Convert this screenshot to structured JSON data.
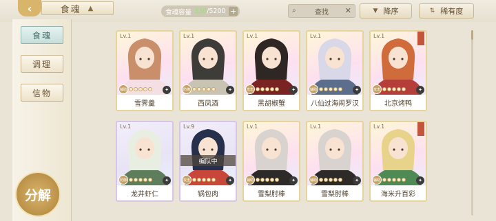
{
  "header": {
    "back_icon": "chevron-left-icon",
    "title": "食魂",
    "capacity_label": "食魂容量",
    "capacity_current": "330",
    "capacity_max": "/5200",
    "search_placeholder": "查找",
    "sort_order_label": "降序",
    "sort_key_label": "稀有度"
  },
  "sidebar": {
    "tabs": [
      {
        "label": "食魂",
        "active": true
      },
      {
        "label": "调理",
        "active": false
      },
      {
        "label": "信物",
        "active": false
      }
    ],
    "decompose_label": "分解"
  },
  "cards": [
    {
      "level": "Lv.1",
      "name": "雪霁羹",
      "role": "辅助",
      "team": "",
      "hair": "#c98f6a",
      "robe": "#f3dfe4",
      "flag": false
    },
    {
      "level": "Lv.1",
      "name": "西凤酒",
      "role": "防御",
      "team": "",
      "hair": "#3e3c38",
      "robe": "#c9c3b4",
      "flag": false
    },
    {
      "level": "Lv.1",
      "name": "黑胡椒蟹",
      "role": "攻击",
      "team": "",
      "hair": "#2f2723",
      "robe": "#7a2323",
      "flag": false
    },
    {
      "level": "Lv.1",
      "name": "八仙过海闹罗汉",
      "role": "辅助",
      "team": "",
      "hair": "#d9d8e8",
      "robe": "#5b6f8c",
      "flag": false
    },
    {
      "level": "Lv.1",
      "name": "北京烤鸭",
      "role": "攻击",
      "team": "",
      "hair": "#d06b3c",
      "robe": "#b63e3a",
      "flag": true
    },
    {
      "level": "Lv.1",
      "name": "龙井虾仁",
      "role": "防御",
      "team": "",
      "hair": "#e9eee2",
      "robe": "#5e7d5b",
      "flag": false
    },
    {
      "level": "Lv.9",
      "name": "锅包肉",
      "role": "攻击",
      "team": "编队中",
      "hair": "#26304d",
      "robe": "#c8473a",
      "flag": false
    },
    {
      "level": "Lv.1",
      "name": "雪梨肘棒",
      "role": "辅助",
      "team": "",
      "hair": "#d8d3cf",
      "robe": "#2e2a28",
      "flag": false
    },
    {
      "level": "Lv.1",
      "name": "雪梨肘棒",
      "role": "辅助",
      "team": "",
      "hair": "#d8d3cf",
      "robe": "#2e2a28",
      "flag": false
    },
    {
      "level": "Lv.1",
      "name": "海米升百彩",
      "role": "辅助",
      "team": "",
      "hair": "#e8d38a",
      "robe": "#4f8a55",
      "flag": true
    }
  ],
  "colors": {
    "accent_gold": "#d9b56b",
    "active_tab": "#c7dedb"
  }
}
